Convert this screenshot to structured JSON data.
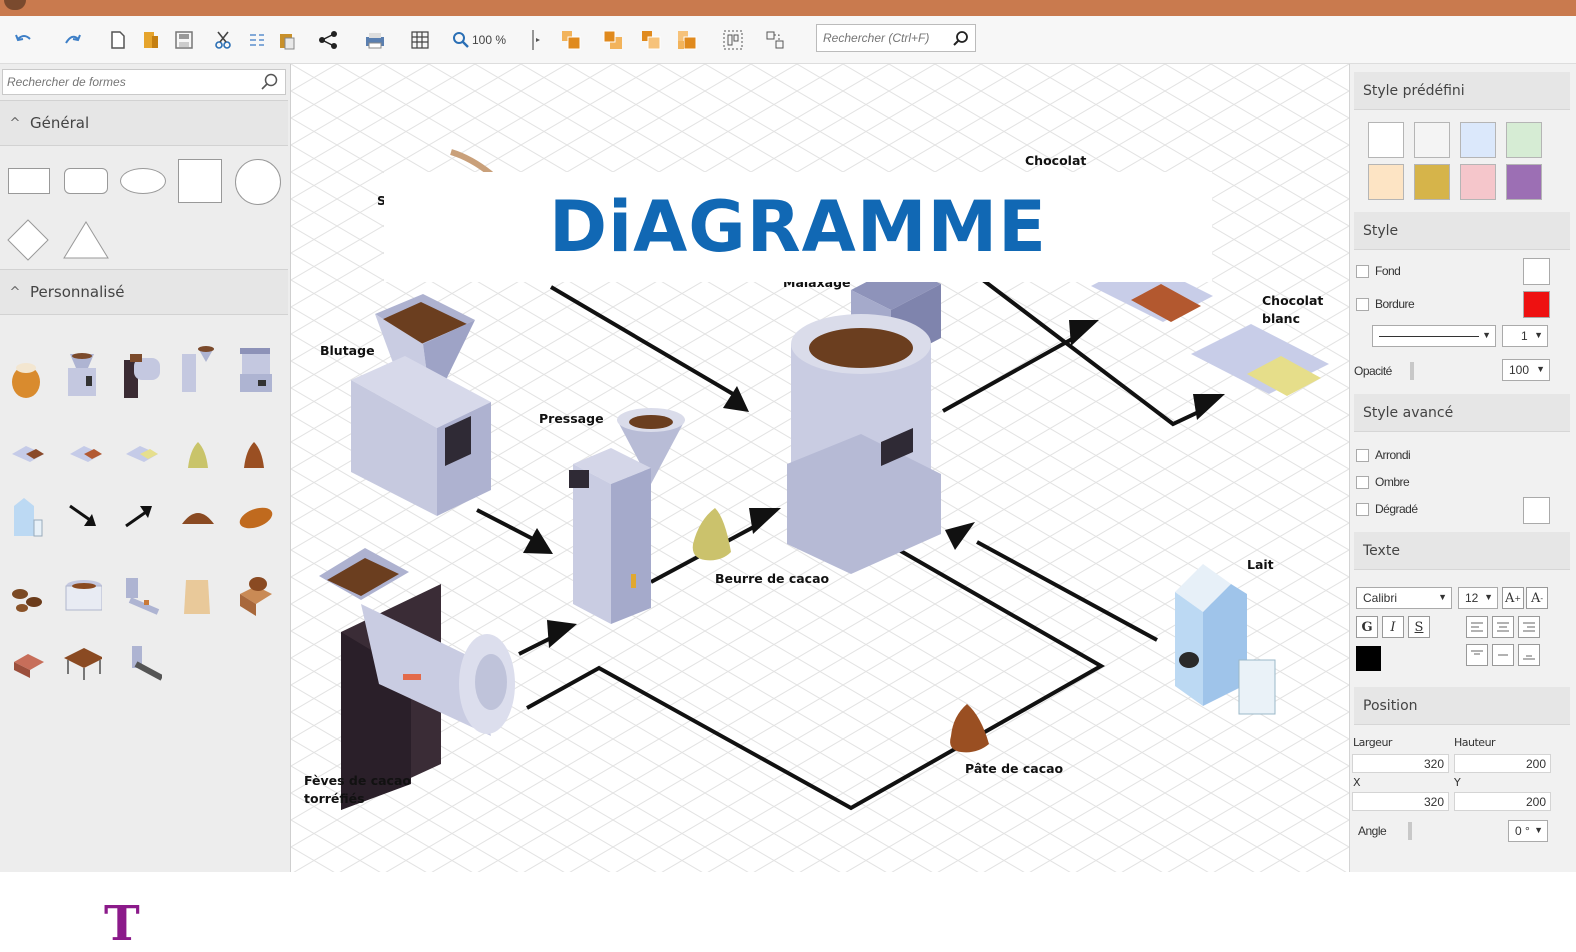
{
  "toolbar": {
    "zoom": "100 %",
    "search_placeholder": "Rechercher (Ctrl+F)",
    "icons": [
      "undo-icon",
      "redo-icon",
      "new-icon",
      "open-icon",
      "save-icon",
      "cut-icon",
      "format-icon",
      "paste-icon",
      "share-icon",
      "print-icon",
      "grid-icon",
      "zoom-icon",
      "snap-icon",
      "bring-front-icon",
      "send-back-icon",
      "bring-forward-icon",
      "send-backward-icon",
      "group-icon",
      "ungroup-icon"
    ]
  },
  "sidebar": {
    "search_placeholder": "Rechercher de formes",
    "section_general": "Général",
    "section_custom": "Personnalisé",
    "logo_letter": "T"
  },
  "canvas": {
    "banner": "DiAGRAMME",
    "labels": {
      "chocolat_top": "Chocolat",
      "malaxage": "Malaxage",
      "chocolat_blanc": "Chocolat\nblanc",
      "blutage": "Blutage",
      "pressage": "Pressage",
      "beurre": "Beurre de cacao",
      "lait": "Lait",
      "pate": "Pâte de cacao",
      "feves": "Fèves de cacao\ntorréfiés",
      "s_partial": "S"
    }
  },
  "panel": {
    "style_predefini": "Style prédéfini",
    "swatches": [
      "#ffffff",
      "#f4f4f4",
      "#dbe8fb",
      "#d6ecd4",
      "#fde4c4",
      "#d6b44a",
      "#f5c6cb",
      "#9c6fb4"
    ],
    "style": "Style",
    "fond": "Fond",
    "bordure": "Bordure",
    "fond_color": "#ffffff",
    "bordure_color": "#ee1111",
    "line_width": "1",
    "opacite": "Opacité",
    "opacite_value": "100",
    "style_avance": "Style avancé",
    "arrondi": "Arrondi",
    "ombre": "Ombre",
    "degrade": "Dégradé",
    "texte": "Texte",
    "font_name": "Calibri",
    "font_size": "12",
    "grow_a": "A",
    "shrink_a": "A",
    "bold": "G",
    "italic": "I",
    "underline": "S",
    "text_color": "#000000",
    "position": "Position",
    "largeur_label": "Largeur",
    "hauteur_label": "Hauteur",
    "largeur": "320",
    "hauteur": "200",
    "x_label": "X",
    "y_label": "Y",
    "x": "320",
    "y": "200",
    "angle_label": "Angle",
    "angle": "0 °"
  }
}
